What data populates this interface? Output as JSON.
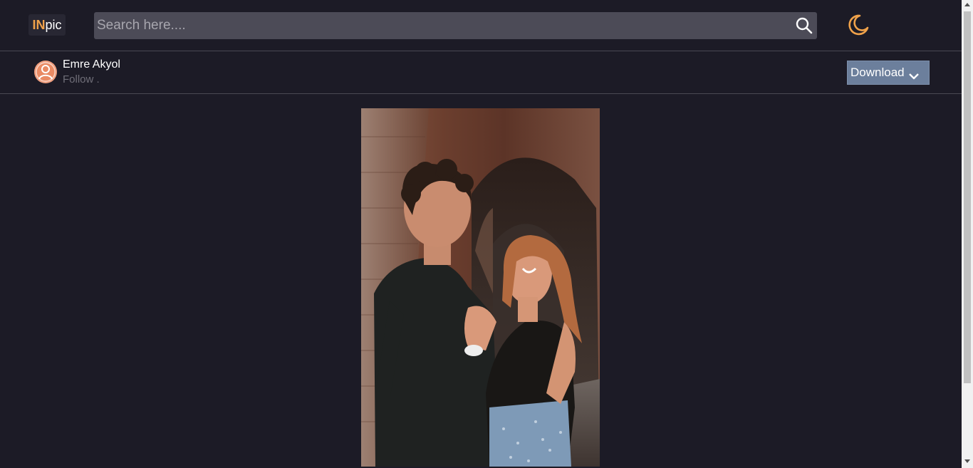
{
  "header": {
    "logo": {
      "part1": "IN",
      "part2": "pic"
    },
    "search": {
      "placeholder": "Search here....",
      "value": ""
    },
    "search_icon": "search-icon",
    "theme_icon": "moon-icon"
  },
  "author": {
    "name": "Emre Akyol",
    "follow_label": "Follow .",
    "avatar_icon": "user-circle-icon"
  },
  "actions": {
    "download_label": "Download",
    "download_icon": "chevron-down-icon"
  },
  "colors": {
    "background": "#1c1b26",
    "accent": "#f0a24a",
    "download_button": "#6c7f9c",
    "search_background": "#4c4b57"
  }
}
